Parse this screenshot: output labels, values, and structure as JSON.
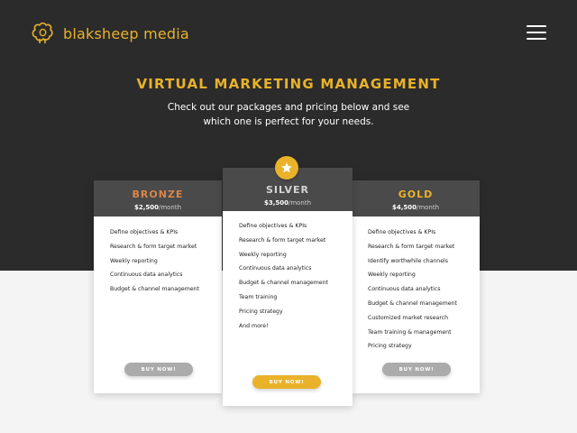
{
  "brand": {
    "name": "blaksheep media",
    "logo_icon": "sheep-icon",
    "accent": "#e9b22a"
  },
  "header": {
    "menu_icon": "hamburger-menu-icon"
  },
  "hero": {
    "title": "VIRTUAL MARKETING MANAGEMENT",
    "subtitle": "Check out our packages and pricing below and see which one is perfect for your needs."
  },
  "plans": [
    {
      "name": "BRONZE",
      "price": "$2,500",
      "per": "/month",
      "color": "#d9864a",
      "features": [
        "Define objectives & KPIs",
        "Research & form target market",
        "Weekly reporting",
        "Continuous data analytics",
        "Budget & channel management"
      ],
      "button": "BUY NOW!"
    },
    {
      "name": "SILVER",
      "price": "$3,500",
      "per": "/month",
      "color": "#d4d4d4",
      "featured": true,
      "badge_icon": "star-icon",
      "features": [
        "Define objectives & KPIs",
        "Research & form target market",
        "Weekly reporting",
        "Continuous data analytics",
        "Budget & channel management",
        "Team training",
        "Pricing strategy",
        "And more!"
      ],
      "button": "BUY NOW!"
    },
    {
      "name": "GOLD",
      "price": "$4,500",
      "per": "/month",
      "color": "#e9b22a",
      "features": [
        "Define objectives & KPIs",
        "Research & form target market",
        "Identify worthwhile channels",
        "Weekly reporting",
        "Continuous data analytics",
        "Budget & channel management",
        "Customized market research",
        "Team training & management",
        "Pricing strategy"
      ],
      "button": "BUY NOW!"
    }
  ]
}
